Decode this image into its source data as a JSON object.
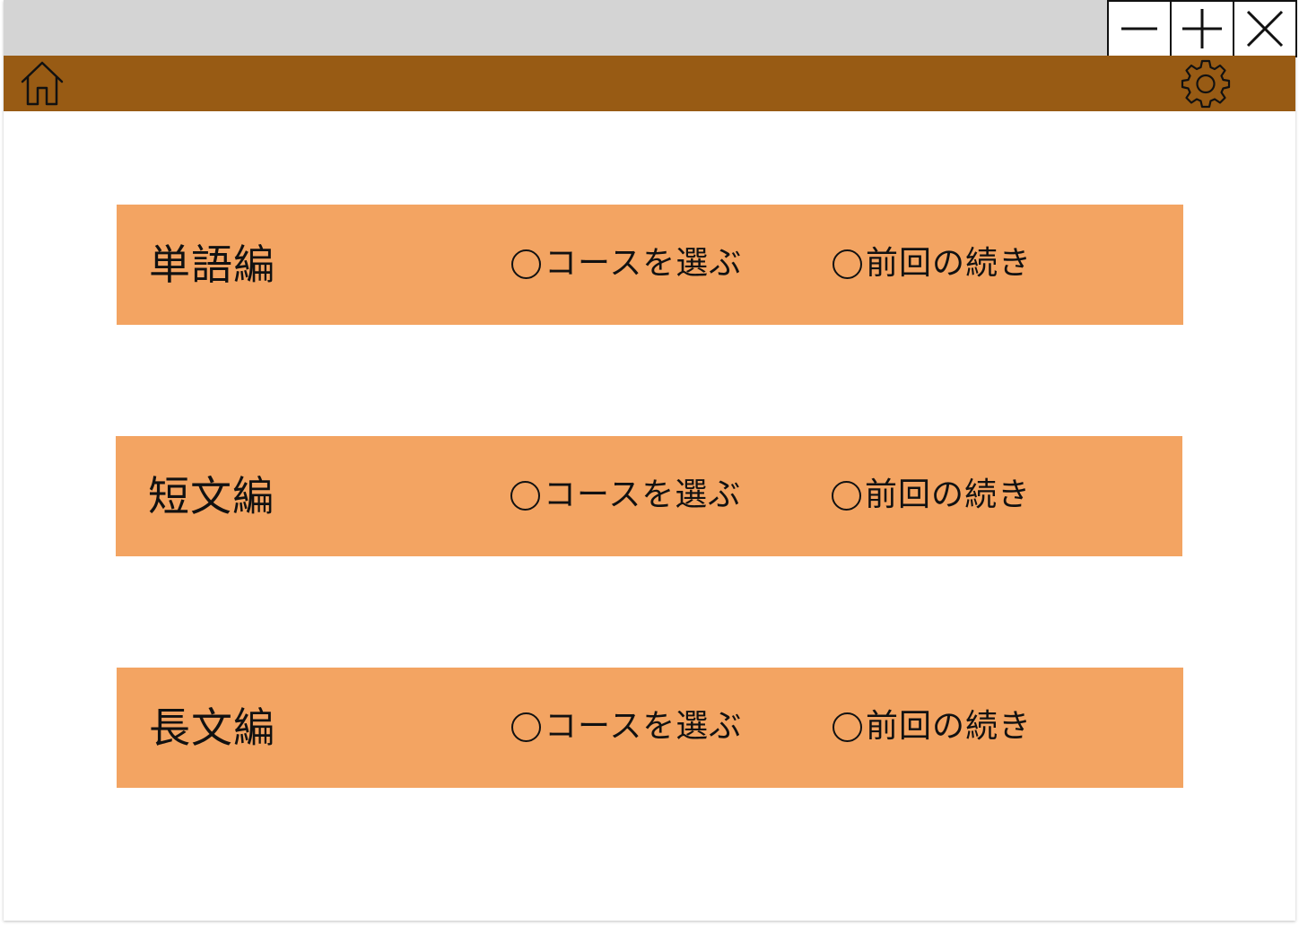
{
  "window_controls": {
    "minimize_icon": "minus-icon",
    "maximize_icon": "plus-icon",
    "close_icon": "close-icon"
  },
  "toolbar": {
    "background_color": "#985b14",
    "home_icon": "home-icon",
    "settings_icon": "gear-icon"
  },
  "courses": [
    {
      "title": "単語編",
      "select_label": "コースを選ぶ",
      "resume_label": "前回の続き"
    },
    {
      "title": "短文編",
      "select_label": "コースを選ぶ",
      "resume_label": "前回の続き"
    },
    {
      "title": "長文編",
      "select_label": "コースを選ぶ",
      "resume_label": "前回の続き"
    }
  ],
  "colors": {
    "titlebar": "#d4d4d4",
    "row_background": "#f3a462"
  }
}
